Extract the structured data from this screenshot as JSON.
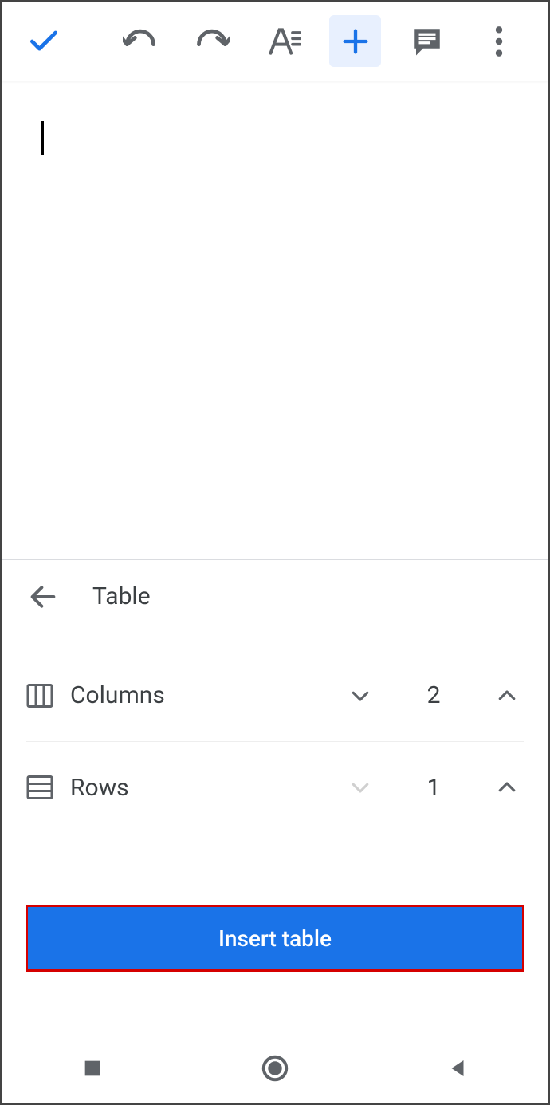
{
  "toolbar": {
    "done": "done",
    "undo": "undo",
    "redo": "redo",
    "format": "format",
    "insert": "insert",
    "comment": "comment",
    "more": "more"
  },
  "panel": {
    "title": "Table",
    "columns_label": "Columns",
    "columns_value": "2",
    "rows_label": "Rows",
    "rows_value": "1",
    "insert_button": "Insert table"
  }
}
